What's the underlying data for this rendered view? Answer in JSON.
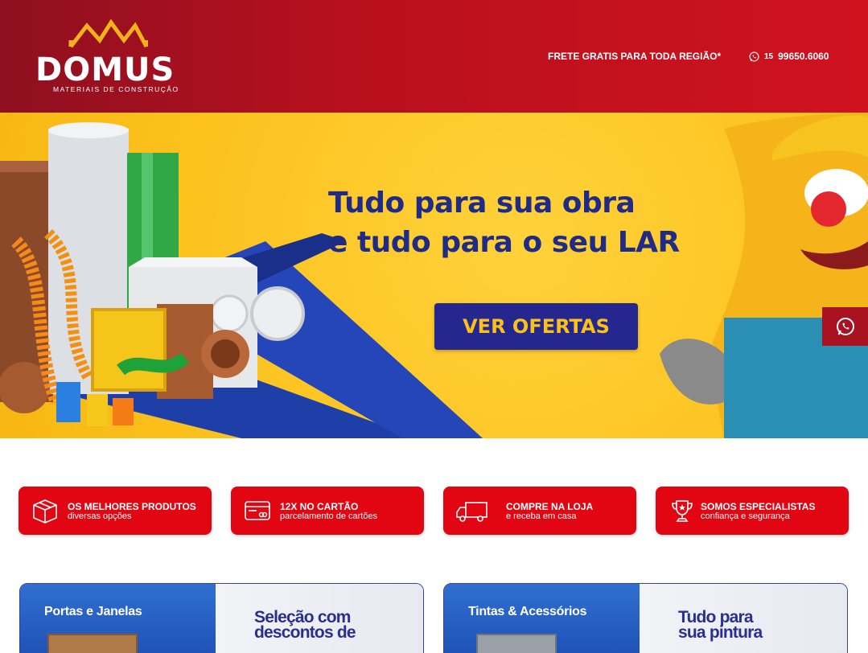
{
  "header": {
    "logo_text": "DOMUS",
    "logo_subtitle": "MATERIAIS DE CONSTRUÇÃO",
    "freight_text": "FRETE GRATIS PARA TODA REGIÃO*",
    "phone_area": "15",
    "phone_number": "99650.6060",
    "phone_icon": "whatsapp-icon"
  },
  "banner": {
    "headline_line1": "Tudo para sua obra",
    "headline_line2": "e tudo para o seu LAR",
    "cta_label": "VER OFERTAS"
  },
  "floating": {
    "icon": "whatsapp-icon"
  },
  "features": [
    {
      "icon": "box-icon",
      "title": "OS MELHORES PRODUTOS",
      "subtitle": "diversas opções"
    },
    {
      "icon": "credit-card-icon",
      "title": "12X NO CARTÃO",
      "subtitle": "parcelamento de cartões"
    },
    {
      "icon": "truck-icon",
      "title": "COMPRE NA LOJA",
      "subtitle": "e receba em casa"
    },
    {
      "icon": "trophy-icon",
      "title": "SOMOS ESPECIALISTAS",
      "subtitle": "confiança e segurança"
    }
  ],
  "categories": [
    {
      "title": "Portas e Janelas",
      "promo_line1": "Seleção com",
      "promo_line2": "descontos de"
    },
    {
      "title": "Tintas & Acessórios",
      "promo_line1": "Tudo para",
      "promo_line2": "sua pintura"
    }
  ],
  "colors": {
    "header_red": "#c0111f",
    "feature_red": "#e20613",
    "banner_yellow": "#fcc21e",
    "navy": "#1f2b84"
  }
}
